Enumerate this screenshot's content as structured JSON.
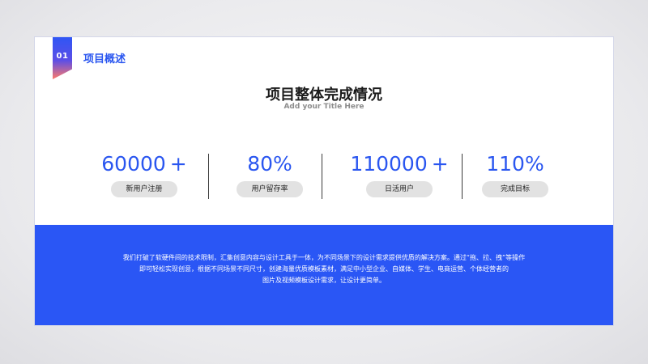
{
  "section": {
    "number": "01",
    "title": "项目概述"
  },
  "header": {
    "title": "项目整体完成情况",
    "subtitle": "Add your Title Here"
  },
  "stats": [
    {
      "value": "60000 +",
      "label": "新用户注册"
    },
    {
      "value": "80%",
      "label": "用户留存率"
    },
    {
      "value": "110000 +",
      "label": "日活用户"
    },
    {
      "value": "110%",
      "label": "完成目标"
    }
  ],
  "description": {
    "lines": [
      "我们打破了软硬件间的技术限制，汇集创意内容与设计工具于一体，为不同场景下的设计需求提供优质的解决方案。通过“拖、拉、拽”等操作",
      "即可轻松实现创意，根据不同场景不同尺寸，创建海量优质模板素材，满足中小型企业、自媒体、学生、电商运营、个体经营者的",
      "图片及视频模板设计需求，让设计更简单。"
    ]
  },
  "colors": {
    "accent": "#2a56f5",
    "ribbon_end": "#ff7a6a",
    "pill": "#e2e2e2"
  }
}
